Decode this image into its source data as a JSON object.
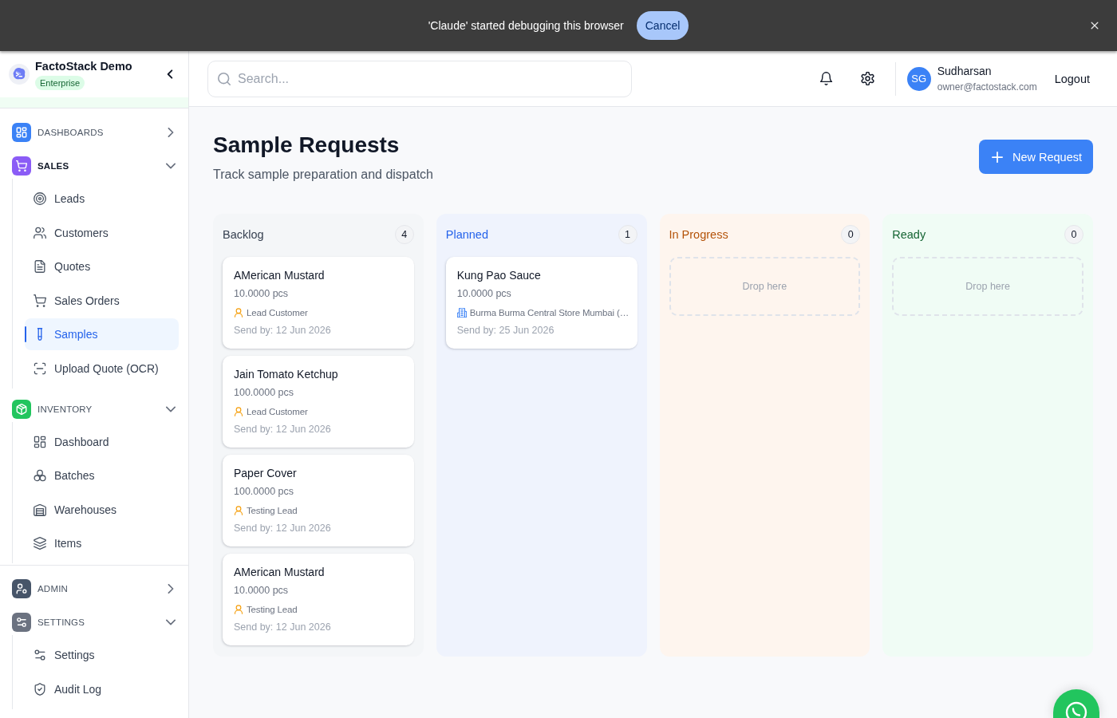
{
  "debug_banner": {
    "message": "'Claude' started debugging this browser",
    "action": "Cancel"
  },
  "sidebar": {
    "brand": {
      "name": "FactoStack Demo",
      "plan": "Enterprise"
    },
    "groups": [
      {
        "sections": [
          {
            "label": "DASHBOARDS",
            "color": "#3b82f6",
            "expanded": false,
            "active": false
          },
          {
            "label": "SALES",
            "color": "#8b5cf6",
            "expanded": true,
            "active": true,
            "children": [
              {
                "label": "Leads",
                "selected": false
              },
              {
                "label": "Customers",
                "selected": false
              },
              {
                "label": "Quotes",
                "selected": false
              },
              {
                "label": "Sales Orders",
                "selected": false
              },
              {
                "label": "Samples",
                "selected": true
              },
              {
                "label": "Upload Quote (OCR)",
                "selected": false
              }
            ]
          },
          {
            "label": "INVENTORY",
            "color": "#22c55e",
            "expanded": true,
            "active": false,
            "children": [
              {
                "label": "Dashboard",
                "selected": false
              },
              {
                "label": "Batches",
                "selected": false
              },
              {
                "label": "Warehouses",
                "selected": false
              },
              {
                "label": "Items",
                "selected": false
              }
            ]
          }
        ]
      },
      {
        "sections": [
          {
            "label": "ADMIN",
            "color": "#475569",
            "expanded": false,
            "active": false
          },
          {
            "label": "SETTINGS",
            "color": "#6b7280",
            "expanded": true,
            "active": false,
            "children": [
              {
                "label": "Settings",
                "selected": false
              },
              {
                "label": "Audit Log",
                "selected": false
              }
            ]
          }
        ]
      }
    ]
  },
  "header": {
    "search": {
      "placeholder": "Search..."
    },
    "user": {
      "initials": "SG",
      "name": "Sudharsan",
      "email": "owner@factostack.com"
    },
    "logout": "Logout"
  },
  "page": {
    "title": "Sample Requests",
    "subtitle": "Track sample preparation and dispatch",
    "primary_action": "New Request"
  },
  "board": {
    "columns": [
      {
        "title": "Backlog",
        "count": "4",
        "color": "#374151",
        "cards": [
          {
            "title": "AMerican Mustard",
            "quantity": "10.0000 pcs",
            "contact": {
              "kind": "lead",
              "name": "Lead Customer"
            },
            "send_by": "Send by: 12 Jun 2026"
          },
          {
            "title": "Jain Tomato Ketchup",
            "quantity": "100.0000 pcs",
            "contact": {
              "kind": "lead",
              "name": "Lead Customer"
            },
            "send_by": "Send by: 12 Jun 2026"
          },
          {
            "title": "Paper Cover",
            "quantity": "100.0000 pcs",
            "contact": {
              "kind": "lead",
              "name": "Testing Lead"
            },
            "send_by": "Send by: 12 Jun 2026"
          },
          {
            "title": "AMerican Mustard",
            "quantity": "10.0000 pcs",
            "contact": {
              "kind": "lead",
              "name": "Testing Lead"
            },
            "send_by": "Send by: 12 Jun 2026"
          }
        ]
      },
      {
        "title": "Planned",
        "count": "1",
        "color": "#2563eb",
        "cards": [
          {
            "title": "Kung Pao Sauce",
            "quantity": "10.0000 pcs",
            "contact": {
              "kind": "customer",
              "name": "Burma Burma Central Store Mumbai (…"
            },
            "send_by": "Send by: 25 Jun 2026"
          }
        ]
      },
      {
        "title": "In Progress",
        "count": "0",
        "color": "#b45309",
        "drop_hint": "Drop here"
      },
      {
        "title": "Ready",
        "count": "0",
        "color": "#166534",
        "drop_hint": "Drop here"
      }
    ]
  }
}
